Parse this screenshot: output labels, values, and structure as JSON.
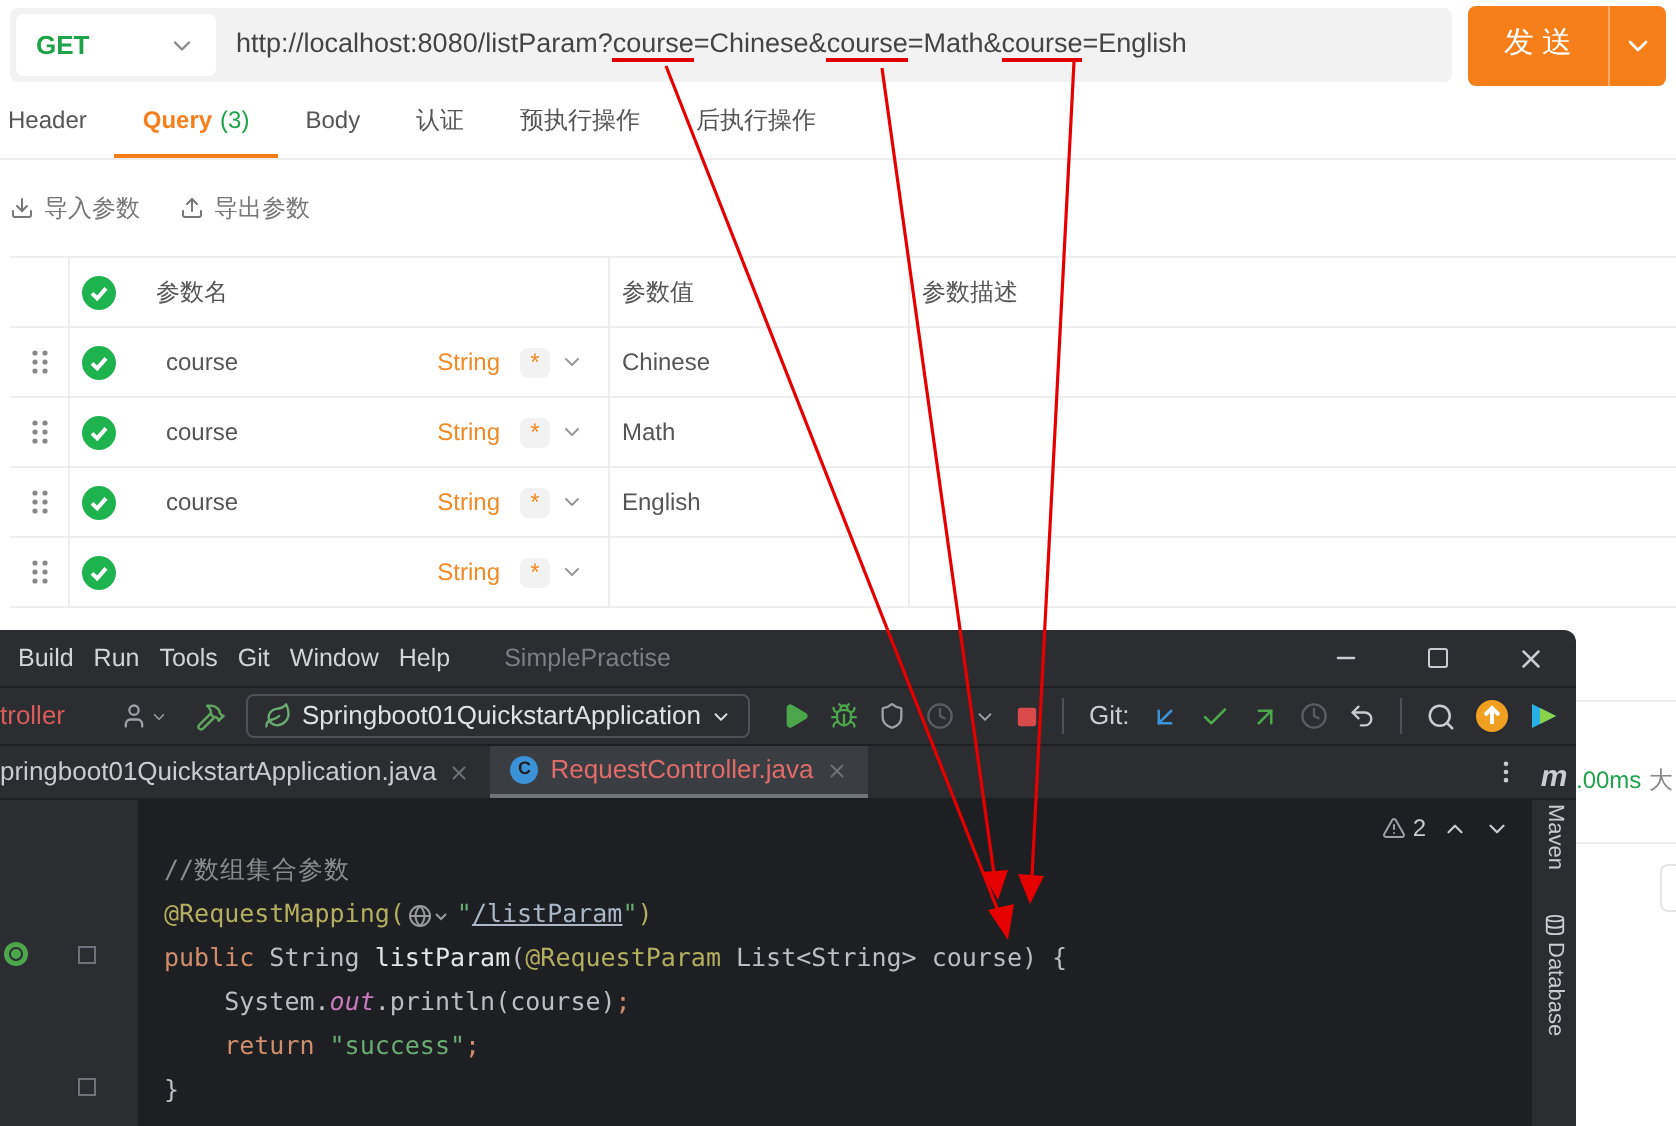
{
  "request": {
    "method": "GET",
    "url": [
      {
        "text": "http://localhost:8080/listParam?",
        "underlined": false
      },
      {
        "text": "course",
        "underlined": true
      },
      {
        "text": "=Chinese&",
        "underlined": false
      },
      {
        "text": "course",
        "underlined": true
      },
      {
        "text": "=Math&",
        "underlined": false
      },
      {
        "text": "course",
        "underlined": true
      },
      {
        "text": "=English",
        "underlined": false
      }
    ],
    "send_label": "发送"
  },
  "tabs": [
    {
      "label": "Header",
      "selected": false
    },
    {
      "label": "Query",
      "count": "(3)",
      "selected": true
    },
    {
      "label": "Body",
      "selected": false
    },
    {
      "label": "认证",
      "selected": false
    },
    {
      "label": "预执行操作",
      "selected": false
    },
    {
      "label": "后执行操作",
      "selected": false
    }
  ],
  "actions": [
    {
      "kind": "import",
      "label": "导入参数"
    },
    {
      "kind": "export",
      "label": "导出参数"
    }
  ],
  "params_table": {
    "columns": [
      "参数名",
      "参数值",
      "参数描述"
    ],
    "all_enabled": true,
    "rows": [
      {
        "enabled": true,
        "name": "course",
        "type": "String",
        "required_mark": "*",
        "value": "Chinese"
      },
      {
        "enabled": true,
        "name": "course",
        "type": "String",
        "required_mark": "*",
        "value": "Math"
      },
      {
        "enabled": true,
        "name": "course",
        "type": "String",
        "required_mark": "*",
        "value": "English"
      },
      {
        "enabled": true,
        "type": "String",
        "required_mark": "*"
      }
    ]
  },
  "background_panel": {
    "timing": ".00ms",
    "size_label": "大"
  },
  "ide": {
    "menu": [
      "Build",
      "Run",
      "Tools",
      "Git",
      "Window",
      "Help"
    ],
    "project": "SimplePractise",
    "breadcrumb": "troller",
    "run_config": "Springboot01QuickstartApplication",
    "git_label": "Git:",
    "file_tabs": [
      {
        "label": "pringboot01QuickstartApplication.java",
        "selected": false
      },
      {
        "label": "RequestController.java",
        "selected": true,
        "icon_letter": "C"
      }
    ],
    "warnings": "2",
    "side_logo": "m",
    "side_tools": [
      "Maven",
      "Database"
    ],
    "code_lines": [
      [
        {
          "kind": "comment",
          "text": "//数组集合参数"
        }
      ],
      [
        {
          "kind": "annotation",
          "text": "@RequestMapping("
        },
        {
          "kind": "inlay"
        },
        {
          "kind": "string",
          "text": "\""
        },
        {
          "kind": "link",
          "text": "/listParam"
        },
        {
          "kind": "string",
          "text": "\""
        },
        {
          "kind": "annotation",
          "text": ")"
        }
      ],
      [
        {
          "kind": "keyword",
          "text": "public"
        },
        {
          "kind": "plain",
          "text": " String "
        },
        {
          "kind": "function",
          "text": "listParam"
        },
        {
          "kind": "plain",
          "text": "("
        },
        {
          "kind": "annotation",
          "text": "@RequestParam"
        },
        {
          "kind": "plain",
          "text": " List<String> course) {"
        }
      ],
      [
        {
          "kind": "plain",
          "text": "    System."
        },
        {
          "kind": "field",
          "text": "out"
        },
        {
          "kind": "plain",
          "text": ".println(course)"
        },
        {
          "kind": "keyword",
          "text": ";"
        }
      ],
      [
        {
          "kind": "indent"
        },
        {
          "kind": "keyword",
          "text": "return"
        },
        {
          "kind": "string",
          "text": " \"success\""
        },
        {
          "kind": "keyword",
          "text": ";"
        }
      ],
      [
        {
          "kind": "plain",
          "text": "}"
        }
      ]
    ]
  }
}
